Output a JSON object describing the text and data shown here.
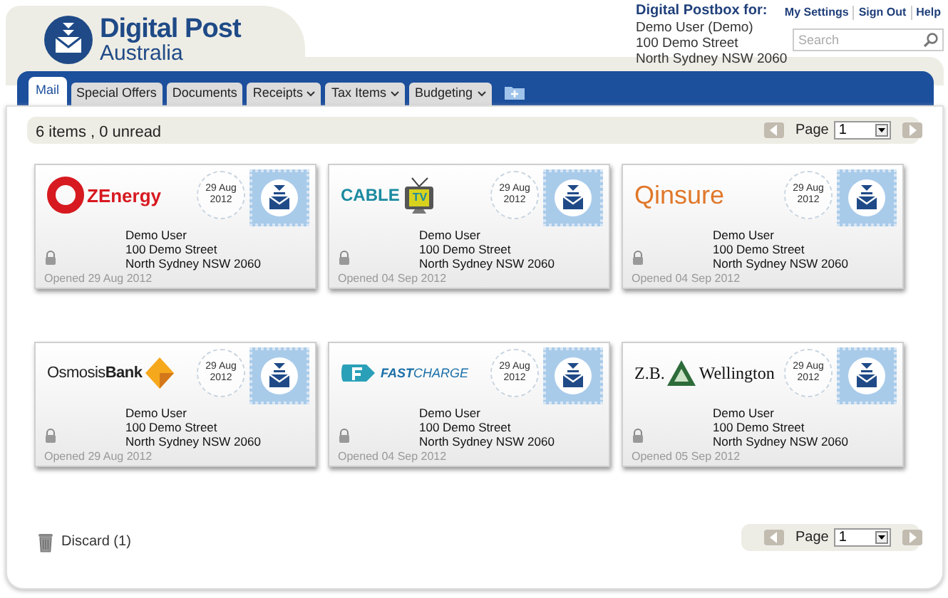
{
  "brand": {
    "name": "Digital Post",
    "sub": "Australia"
  },
  "postbox": {
    "heading": "Digital Postbox for:",
    "lines": [
      "Demo User (Demo)",
      "100 Demo Street",
      "North Sydney NSW 2060"
    ]
  },
  "top_links": [
    "My Settings",
    "Sign Out",
    "Help"
  ],
  "search": {
    "placeholder": "Search"
  },
  "tabs": [
    {
      "label": "Mail",
      "selected": true,
      "dropdown": false
    },
    {
      "label": "Special Offers",
      "selected": false,
      "dropdown": false
    },
    {
      "label": "Documents",
      "selected": false,
      "dropdown": false
    },
    {
      "label": "Receipts",
      "selected": false,
      "dropdown": true
    },
    {
      "label": "Tax Items",
      "selected": false,
      "dropdown": true
    },
    {
      "label": "Budgeting",
      "selected": false,
      "dropdown": true
    }
  ],
  "summary": "6 items , 0 unread",
  "pager_top": {
    "label": "Page",
    "value": "1"
  },
  "mail": [
    {
      "logo": {
        "kind": "ring",
        "text": "ZEnergy",
        "color": "#d71920"
      },
      "postmark": [
        "29 Aug",
        "2012"
      ],
      "address": [
        "Demo User",
        "100 Demo Street",
        "North Sydney NSW 2060"
      ],
      "opened": "Opened 29 Aug 2012"
    },
    {
      "logo": {
        "kind": "tv",
        "text": "CABLE",
        "badge": "TV",
        "color": "#1a8aa0"
      },
      "postmark": [
        "29 Aug",
        "2012"
      ],
      "address": [
        "Demo User",
        "100 Demo Street",
        "North Sydney NSW 2060"
      ],
      "opened": "Opened 04 Sep 2012"
    },
    {
      "logo": {
        "kind": "plain",
        "text": "Qinsure",
        "color": "#e0782a"
      },
      "postmark": [
        "29 Aug",
        "2012"
      ],
      "address": [
        "Demo User",
        "100 Demo Street",
        "North Sydney NSW 2060"
      ],
      "opened": "Opened 04 Sep 2012"
    },
    {
      "logo": {
        "kind": "diamond",
        "text": "Osmosis**Bank**",
        "color": "#222222"
      },
      "postmark": [
        "29 Aug",
        "2012"
      ],
      "address": [
        "Demo User",
        "100 Demo Street",
        "North Sydney NSW 2060"
      ],
      "opened": "Opened 29 Aug 2012"
    },
    {
      "logo": {
        "kind": "arrow",
        "text": "**FAST**CHARGE",
        "color": "#1a6fa8"
      },
      "postmark": [
        "29 Aug",
        "2012"
      ],
      "address": [
        "Demo User",
        "100 Demo Street",
        "North Sydney NSW 2060"
      ],
      "opened": "Opened 04 Sep 2012"
    },
    {
      "logo": {
        "kind": "triangle",
        "text": "Z.B.",
        "text2": "Wellington",
        "color": "#111111"
      },
      "postmark": [
        "29 Aug",
        "2012"
      ],
      "address": [
        "Demo User",
        "100 Demo Street",
        "North Sydney NSW 2060"
      ],
      "opened": "Opened 05 Sep 2012"
    }
  ],
  "discard": "Discard (1)",
  "pager_bottom": {
    "label": "Page",
    "value": "1"
  }
}
